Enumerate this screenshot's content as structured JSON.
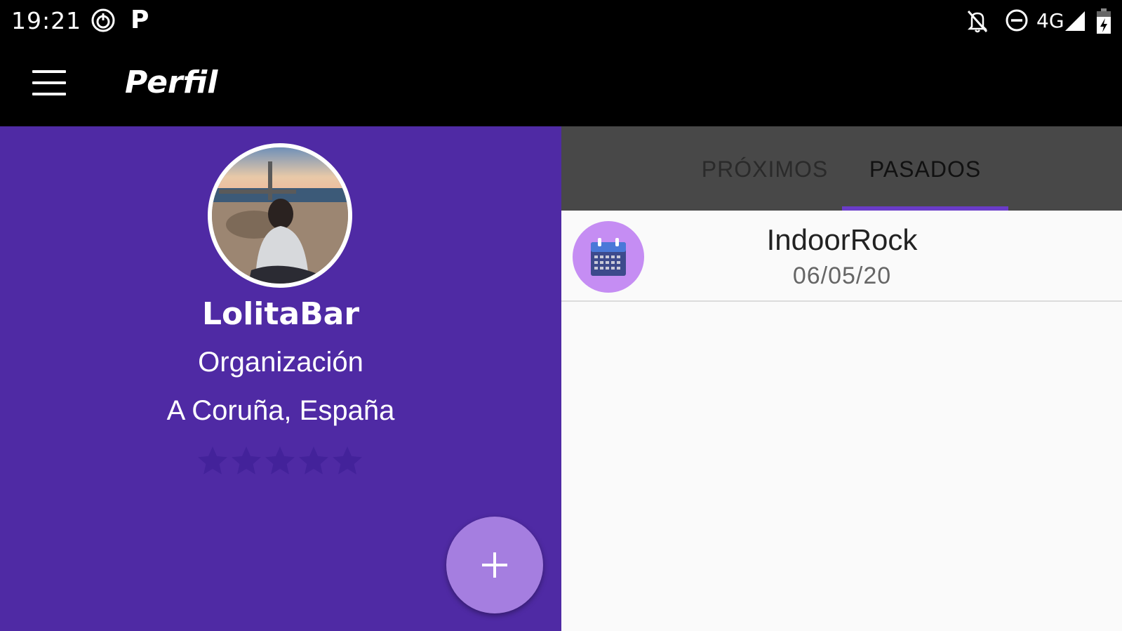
{
  "status_bar": {
    "time": "19:21",
    "network": "4G",
    "icons": [
      "power-icon",
      "parking-p-icon",
      "notifications-off-icon",
      "do-not-disturb-icon",
      "signal-icon",
      "battery-charging-icon"
    ]
  },
  "app_bar": {
    "title": "Perfil",
    "menu_icon": "hamburger-menu-icon"
  },
  "profile": {
    "name": "LolitaBar",
    "type": "Organización",
    "location": "A Coruña, España",
    "rating_stars_total": 5,
    "rating_value": 0
  },
  "tabs": [
    {
      "label": "PRÓXIMOS",
      "selected": false
    },
    {
      "label": "PASADOS",
      "selected": true
    }
  ],
  "events": [
    {
      "name": "IndoorRock",
      "date": "06/05/20",
      "icon": "calendar-icon"
    }
  ],
  "fab": {
    "icon": "plus-icon"
  },
  "colors": {
    "profile_background": "#4f2aa4",
    "fab": "#a57ee0",
    "tab_bar": "#484848",
    "tab_indicator": "#6a3cc8",
    "event_icon_background": "#c58df3",
    "list_background": "#fafafa"
  }
}
